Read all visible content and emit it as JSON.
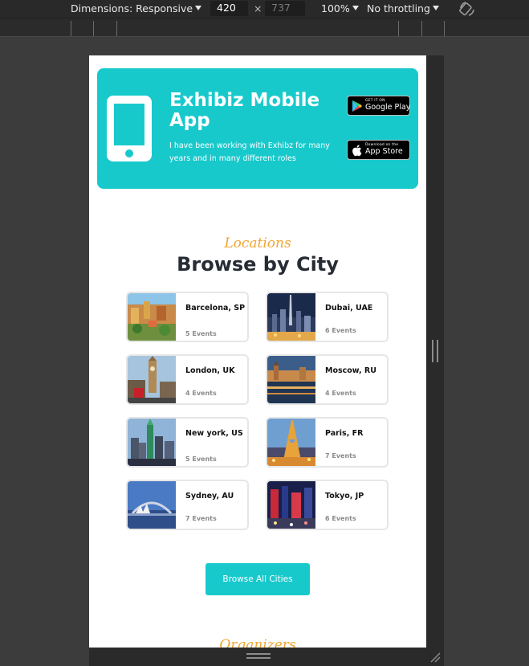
{
  "devtools": {
    "dimensions_label": "Dimensions: Responsive",
    "width_value": "420",
    "height_value": "737",
    "zoom": "100%",
    "throttling": "No throttling",
    "times_symbol": "×"
  },
  "app_banner": {
    "title": "Exhibiz Mobile App",
    "description": "I have been working with Exhibz for many years and in many different roles",
    "google_play": {
      "small": "GET IT ON",
      "big": "Google Play"
    },
    "app_store": {
      "small": "Download on the",
      "big": "App Store"
    },
    "color": "#18c9cc"
  },
  "locations": {
    "kicker": "Locations",
    "title": "Browse by City",
    "cities": [
      {
        "name": "Barcelona, SP",
        "events": "5 Events"
      },
      {
        "name": "Dubai, UAE",
        "events": "6 Events"
      },
      {
        "name": "London, UK",
        "events": "4 Events"
      },
      {
        "name": "Moscow, RU",
        "events": "4 Events"
      },
      {
        "name": "New york, US",
        "events": "5 Events"
      },
      {
        "name": "Paris, FR",
        "events": "7 Events"
      },
      {
        "name": "Sydney, AU",
        "events": "7 Events"
      },
      {
        "name": "Tokyo, JP",
        "events": "6 Events"
      }
    ],
    "browse_button": "Browse All Cities"
  },
  "next_section": {
    "kicker": "Organizers"
  }
}
